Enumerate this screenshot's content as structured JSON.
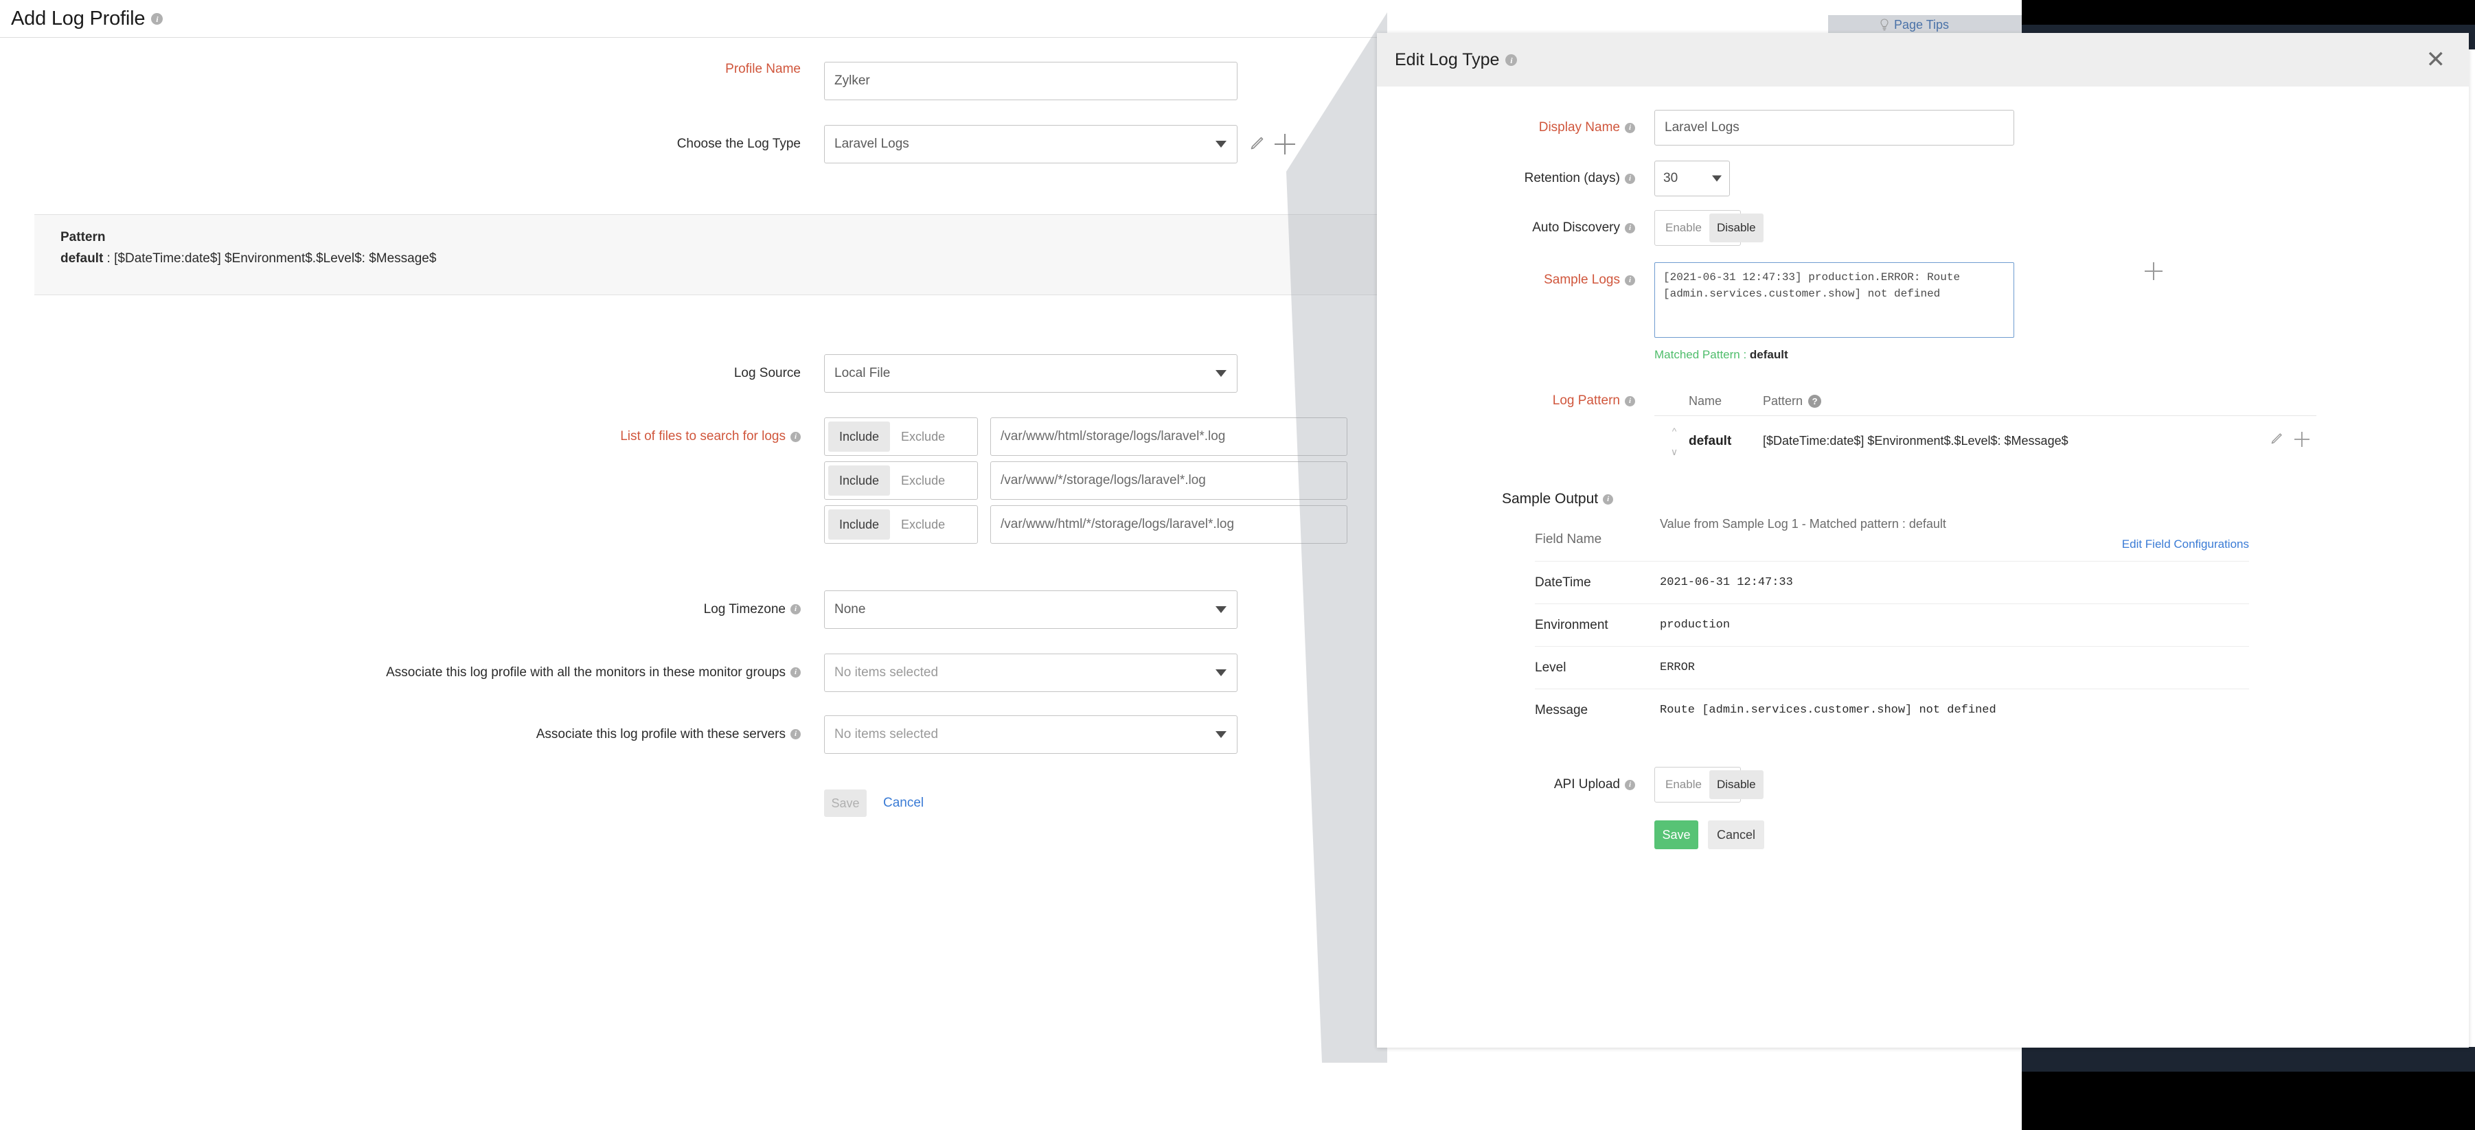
{
  "page": {
    "title": "Add Log Profile",
    "tips_label": "Page Tips"
  },
  "profile_form": {
    "profile_name_label": "Profile Name",
    "profile_name_value": "Zylker",
    "log_type_label": "Choose the Log Type",
    "log_type_value": "Laravel Logs",
    "pattern_header": "Pattern",
    "pattern_name": "default",
    "pattern_sep": " : ",
    "pattern_value": "[$DateTime:date$] $Environment$.$Level$: $Message$",
    "log_source_label": "Log Source",
    "log_source_value": "Local File",
    "files_label": "List of files to search for logs",
    "include_label": "Include",
    "exclude_label": "Exclude",
    "file_rows": [
      {
        "mode": "Include",
        "path": "/var/www/html/storage/logs/laravel*.log"
      },
      {
        "mode": "Include",
        "path": "/var/www/*/storage/logs/laravel*.log"
      },
      {
        "mode": "Include",
        "path": "/var/www/html/*/storage/logs/laravel*.log"
      }
    ],
    "timezone_label": "Log Timezone",
    "timezone_value": "None",
    "monitor_groups_label": "Associate this log profile with all the monitors in these monitor groups",
    "monitor_groups_value": "No items selected",
    "servers_label": "Associate this log profile with these servers",
    "servers_value": "No items selected",
    "save_label": "Save",
    "cancel_label": "Cancel"
  },
  "modal": {
    "title": "Edit Log Type",
    "close_label": "✕",
    "display_name_label": "Display Name",
    "display_name_value": "Laravel Logs",
    "retention_label": "Retention (days)",
    "retention_value": "30",
    "auto_discovery_label": "Auto Discovery",
    "enable_label": "Enable",
    "disable_label": "Disable",
    "auto_discovery_selected": "Disable",
    "sample_logs_label": "Sample Logs",
    "sample_logs_value": "[2021-06-31 12:47:33] production.ERROR: Route [admin.services.customer.show] not defined",
    "matched_pattern_prefix": "Matched Pattern",
    "matched_pattern_sep": " : ",
    "matched_pattern_value": "default",
    "log_pattern_label": "Log Pattern",
    "log_pattern_columns": [
      "Name",
      "Pattern"
    ],
    "log_pattern_rows": [
      {
        "name": "default",
        "pattern": "[$DateTime:date$] $Environment$.$Level$: $Message$"
      }
    ],
    "sample_output_label": "Sample Output",
    "sample_output_field_header": "Field Name",
    "sample_output_value_header": "Value from Sample Log 1 - Matched pattern : default",
    "edit_field_config_label": "Edit Field Configurations",
    "sample_output_rows": [
      {
        "field": "DateTime",
        "value": "2021-06-31 12:47:33"
      },
      {
        "field": "Environment",
        "value": "production"
      },
      {
        "field": "Level",
        "value": "ERROR"
      },
      {
        "field": "Message",
        "value": "Route [admin.services.customer.show] not defined"
      }
    ],
    "api_upload_label": "API Upload",
    "api_upload_selected": "Disable",
    "save_label": "Save",
    "cancel_label": "Cancel"
  },
  "colors": {
    "required": "#d0563c",
    "link": "#3a7bd5",
    "success": "#57c375",
    "matched": "#4fbd6b",
    "navy": "#1c2532"
  }
}
